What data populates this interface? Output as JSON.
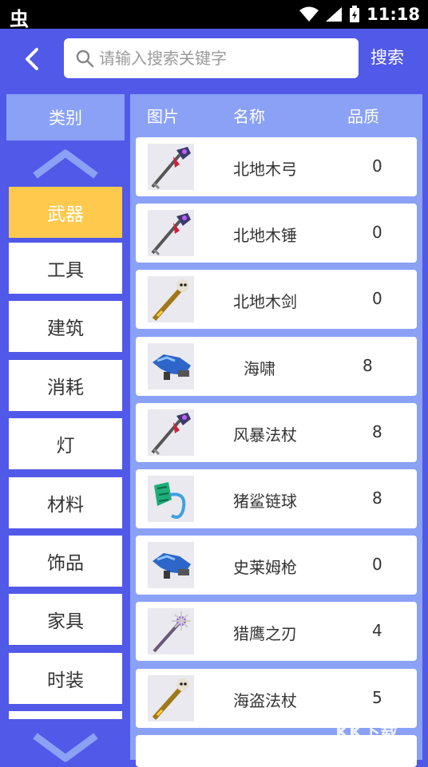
{
  "status_bar": {
    "app_icon": "虫",
    "time": "11:18"
  },
  "header": {
    "search_placeholder": "请输入搜索关键字",
    "search_button": "搜索"
  },
  "categories": {
    "header": "类别",
    "items": [
      "武器",
      "工具",
      "建筑",
      "消耗",
      "灯",
      "材料",
      "饰品",
      "家具",
      "时装"
    ],
    "active": "武器"
  },
  "list": {
    "columns": {
      "image": "图片",
      "name": "名称",
      "quality": "品质"
    },
    "rows": [
      {
        "name": "北地木弓",
        "quality": "0",
        "icon": "staff-red-icon"
      },
      {
        "name": "北地木锤",
        "quality": "0",
        "icon": "staff-red-icon"
      },
      {
        "name": "北地木剑",
        "quality": "0",
        "icon": "skull-staff-icon"
      },
      {
        "name": "海啸",
        "quality": "8",
        "icon": "blue-gun-icon"
      },
      {
        "name": "风暴法杖",
        "quality": "8",
        "icon": "staff-red-icon"
      },
      {
        "name": "猪鲨链球",
        "quality": "8",
        "icon": "green-flail-icon"
      },
      {
        "name": "史莱姆枪",
        "quality": "0",
        "icon": "blue-gun-icon"
      },
      {
        "name": "猎鹰之刃",
        "quality": "4",
        "icon": "spike-staff-icon"
      },
      {
        "name": "海盗法杖",
        "quality": "5",
        "icon": "skull-staff-icon"
      }
    ]
  },
  "watermark": {
    "text": "KK下载",
    "url": "www.kkx.net"
  },
  "colors": {
    "background": "#5159e8",
    "panel": "#8aa1f6",
    "active": "#ffc94e"
  }
}
